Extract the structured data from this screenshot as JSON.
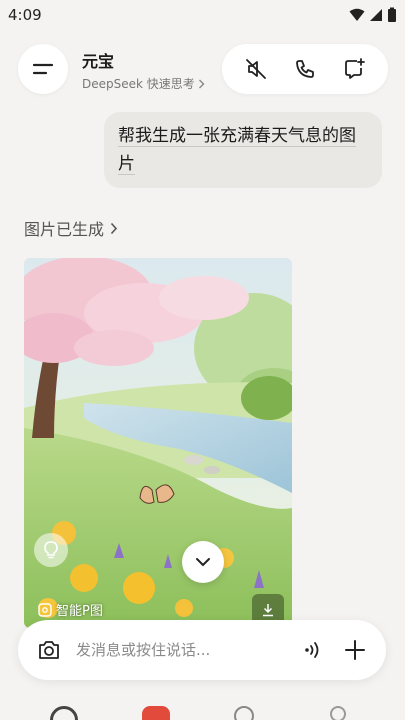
{
  "status": {
    "time": "4:09"
  },
  "header": {
    "title": "元宝",
    "model": "DeepSeek 快速思考"
  },
  "message": {
    "text": "帮我生成一张充满春天气息的图片"
  },
  "result": {
    "link_label": "图片已生成",
    "badge_label": "智能P图"
  },
  "composer": {
    "placeholder": "发消息或按住说话..."
  },
  "colors": {
    "accent": "#e24a3b",
    "background": "#f4f3f1"
  }
}
